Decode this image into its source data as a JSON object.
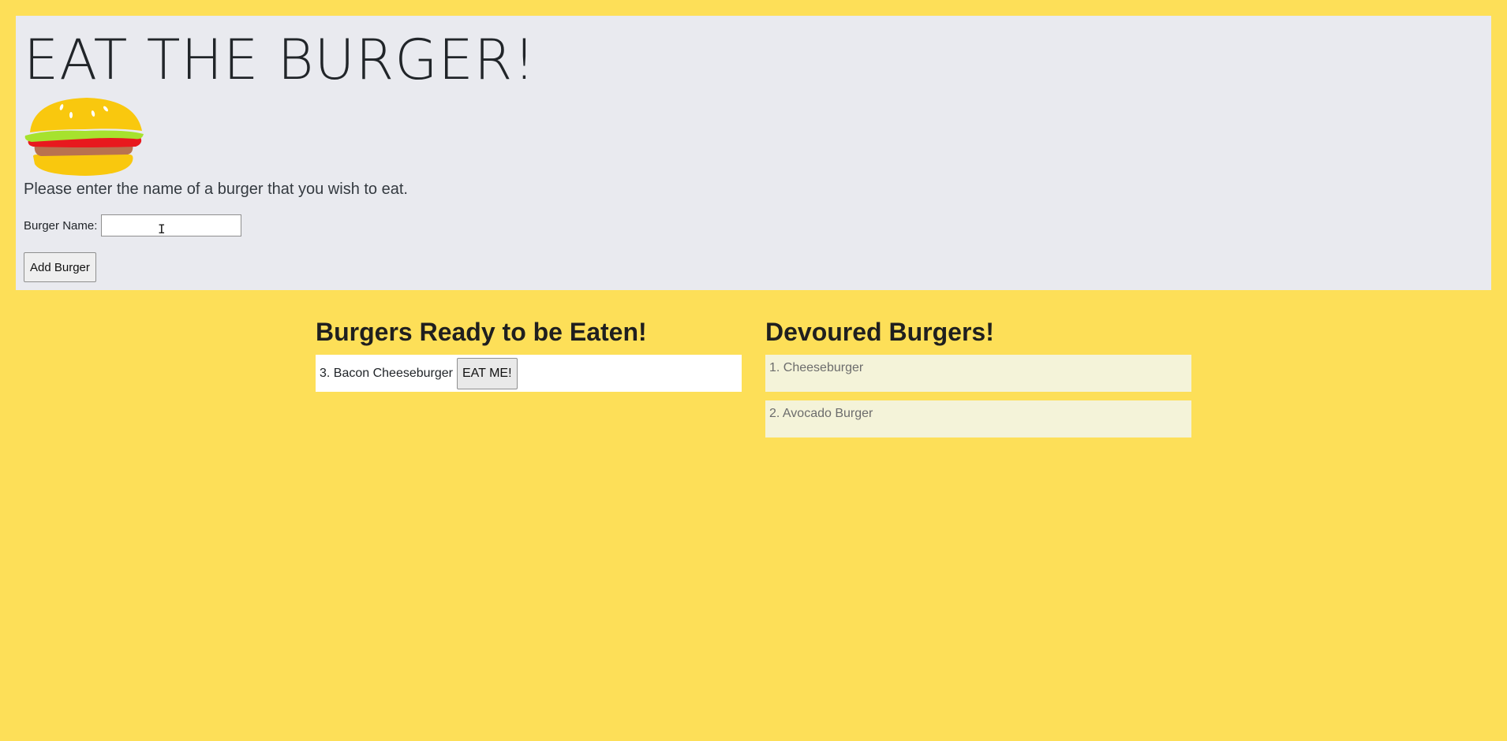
{
  "header": {
    "title": "EAT THE BURGER!",
    "prompt": "Please enter the name of a burger that you wish to eat.",
    "burger_name_label": "Burger Name:",
    "burger_name_value": "",
    "add_button_label": "Add Burger",
    "logo_icon": "burger-icon"
  },
  "ready": {
    "heading": "Burgers Ready to be Eaten!",
    "items": [
      {
        "label": "3. Bacon Cheeseburger",
        "button": "EAT ME!"
      }
    ]
  },
  "devoured": {
    "heading": "Devoured Burgers!",
    "items": [
      {
        "label": "1. Cheeseburger"
      },
      {
        "label": "2. Avocado Burger"
      }
    ]
  },
  "colors": {
    "page_background": "#fddf58",
    "jumbotron_background": "#e9eaef",
    "devoured_item_background": "#f4f3d9"
  }
}
